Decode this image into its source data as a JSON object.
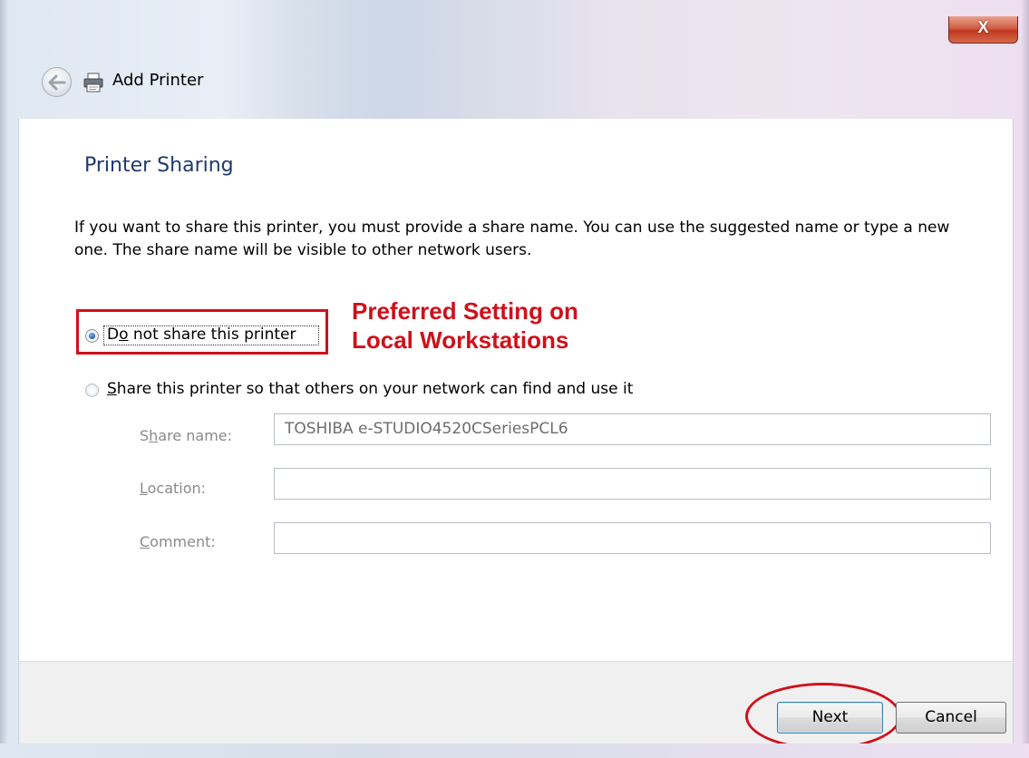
{
  "window": {
    "title": "Add Printer",
    "close_label": "X"
  },
  "page": {
    "heading": "Printer Sharing",
    "description": "If you want to share this printer, you must provide a share name. You can use the suggested name or type a new one. The share name will be visible to other network users."
  },
  "options": {
    "no_share": {
      "label_first": "D",
      "label_underlined": "o",
      "label_rest": " not share this printer",
      "selected": true
    },
    "share": {
      "label_underlined": "S",
      "label_rest": "hare this printer so that others on your network can find and use it",
      "selected": false
    }
  },
  "annotation": {
    "line1": "Preferred Setting on",
    "line2": "Local Workstations",
    "color": "#d0101a"
  },
  "fields": {
    "share_name": {
      "label_first": "S",
      "label_underlined": "h",
      "label_rest": "are name:",
      "value": "TOSHIBA e-STUDIO4520CSeriesPCL6"
    },
    "location": {
      "label_underlined": "L",
      "label_rest": "ocation:",
      "value": ""
    },
    "comment": {
      "label_underlined": "C",
      "label_rest": "omment:",
      "value": ""
    }
  },
  "buttons": {
    "next": "Next",
    "cancel": "Cancel"
  },
  "icons": {
    "back": "back-arrow-icon",
    "printer": "printer-icon"
  },
  "colors": {
    "heading": "#1e3a6e",
    "accent_radio": "#1c5fb8",
    "close": "#c0391f"
  }
}
